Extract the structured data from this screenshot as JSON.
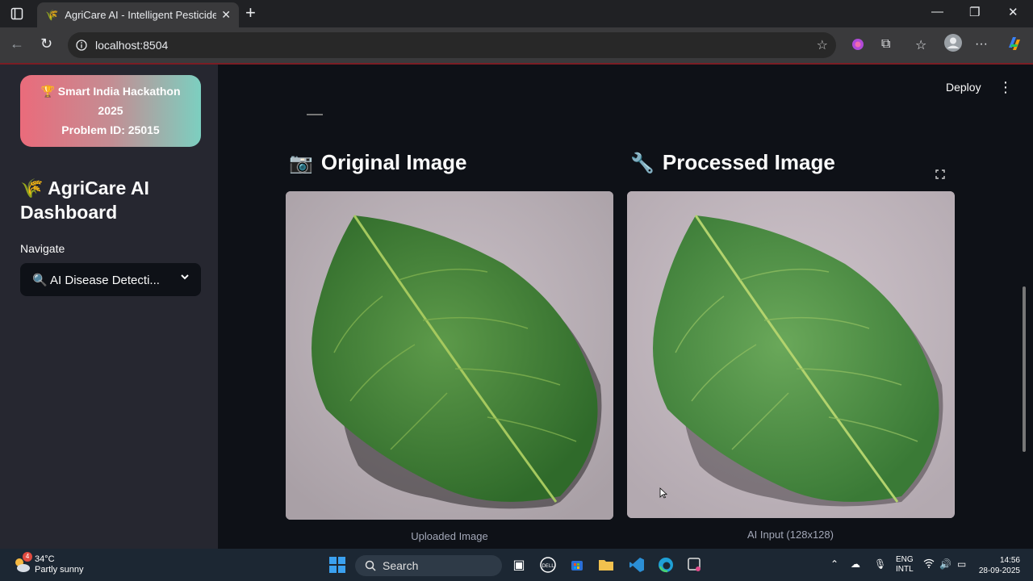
{
  "browser": {
    "tab_title": "AgriCare AI - Intelligent Pesticide",
    "tab_favicon": "🌾",
    "url": "localhost:8504"
  },
  "app": {
    "deploy_label": "Deploy",
    "sidebar": {
      "badge_line1": "🏆 Smart India Hackathon",
      "badge_line2": "2025",
      "badge_line3": "Problem ID: 25015",
      "title": "🌾 AgriCare AI Dashboard",
      "nav_label": "Navigate",
      "nav_selected": "🔍 AI Disease Detecti..."
    },
    "main": {
      "original_title": "Original Image",
      "original_emoji": "📷",
      "processed_title": "Processed Image",
      "processed_emoji": "🔧",
      "original_caption": "Uploaded Image",
      "processed_caption": "AI Input (128x128)"
    }
  },
  "taskbar": {
    "weather_temp": "34°C",
    "weather_desc": "Partly sunny",
    "weather_badge": "4",
    "search_label": "Search",
    "lang_line1": "ENG",
    "lang_line2": "INTL",
    "time": "14:56",
    "date": "28-09-2025"
  }
}
